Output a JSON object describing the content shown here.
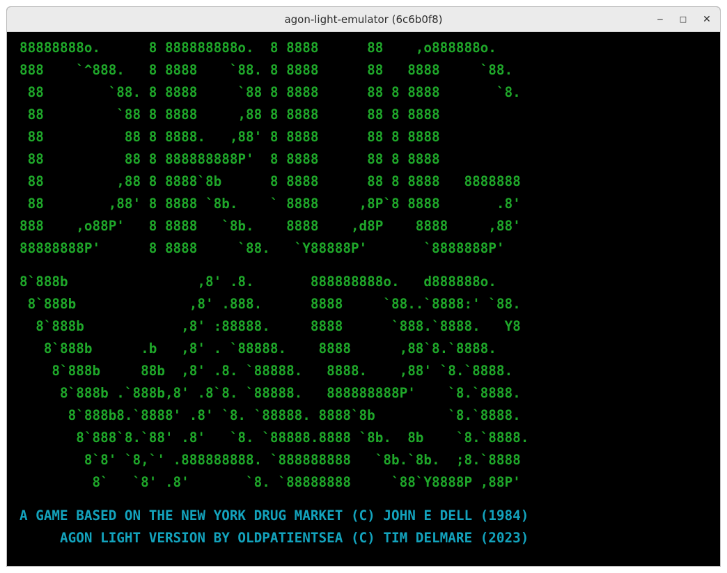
{
  "window": {
    "title": "agon-light-emulator (6c6b0f8)",
    "minimize_glyph": "‒",
    "maximize_glyph": "□",
    "close_glyph": "✕"
  },
  "colors": {
    "screen_bg": "#000000",
    "logo_green": "#1fa82a",
    "credits_cyan": "#13a3bd"
  },
  "logo": {
    "block1": [
      "88888888o.      8 888888888o.  8 8888      88    ,o888888o.",
      "888    `^888.   8 8888    `88. 8 8888      88   8888     `88.",
      " 88        `88. 8 8888     `88 8 8888      88 8 8888       `8.",
      " 88         `88 8 8888     ,88 8 8888      88 8 8888",
      " 88          88 8 8888.   ,88' 8 8888      88 8 8888",
      " 88          88 8 888888888P'  8 8888      88 8 8888",
      " 88         ,88 8 8888`8b      8 8888      88 8 8888   8888888",
      " 88        ,88' 8 8888 `8b.    ` 8888     ,8P`8 8888       .8'",
      "888    ,o88P'   8 8888   `8b.    8888    ,d8P    8888     ,88'",
      "88888888P'      8 8888     `88.   `Y88888P'       `8888888P'"
    ],
    "block2": [
      "8`888b                ,8' .8.       888888888o.   d888888o.",
      " 8`888b              ,8' .888.      8888     `88..`8888:' `88.",
      "  8`888b            ,8' :88888.     8888      `888.`8888.   Y8",
      "   8`888b      .b   ,8' . `88888.    8888      ,88`8.`8888.",
      "    8`888b     88b  ,8' .8. `88888.   8888.    ,88' `8.`8888.",
      "     8`888b .`888b,8' .8`8. `88888.   888888888P'    `8.`8888.",
      "      8`888b8.`8888' .8' `8. `88888. 8888`8b         `8.`8888.",
      "       8`888`8.`88' .8'   `8. `88888.8888 `8b.  8b    `8.`8888.",
      "        8`8' `8,`' .888888888. `888888888   `8b.`8b.  ;8.`8888",
      "         8`   `8' .8'       `8. `88888888     `88`Y8888P ,88P'"
    ]
  },
  "credits": {
    "line1": "A GAME BASED ON THE NEW YORK DRUG MARKET (C) JOHN E DELL (1984)",
    "line2": "     AGON LIGHT VERSION BY OLDPATIENTSEA (C) TIM DELMARE (2023)"
  }
}
